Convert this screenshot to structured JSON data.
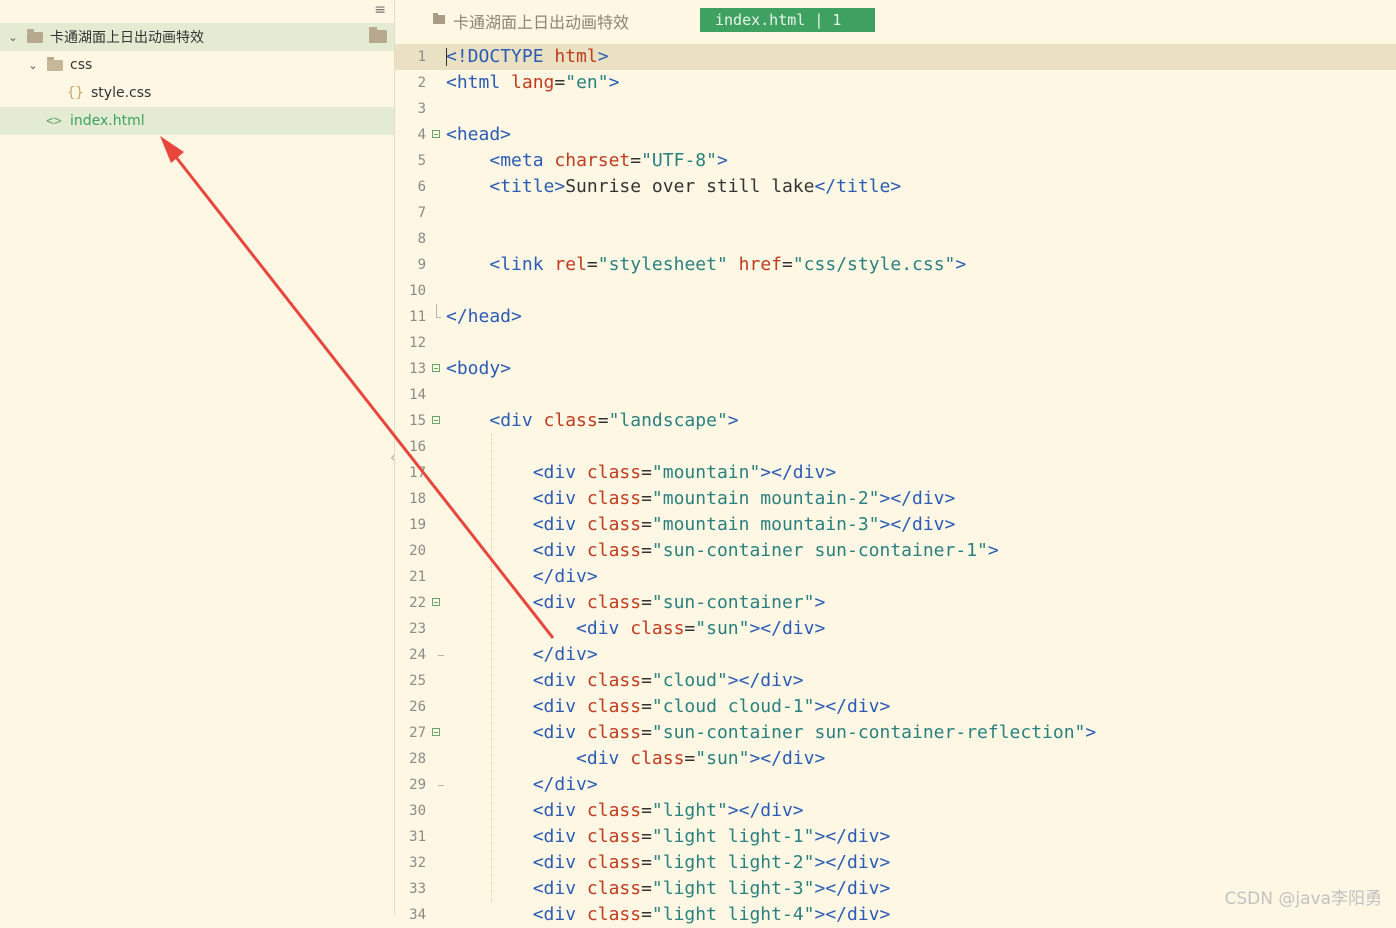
{
  "sidebar": {
    "menu_icon": "hamburger-icon",
    "project_name": "卡通湖面上日出动画特效",
    "folder_css": "css",
    "file_style": "style.css",
    "file_index": "index.html",
    "file_style_icon": "{}",
    "file_index_icon": "<>"
  },
  "editor": {
    "breadcrumb": "卡通湖面上日出动画特效",
    "tab_label": "index.html | 1"
  },
  "code_lines": [
    [
      [
        "t",
        "<!DOCTYPE "
      ],
      [
        "a",
        "html"
      ],
      [
        "t",
        ">"
      ]
    ],
    [
      [
        "t",
        "<html "
      ],
      [
        "a",
        "lang"
      ],
      [
        "x",
        "="
      ],
      [
        "s",
        "\"en\""
      ],
      [
        "t",
        ">"
      ]
    ],
    [],
    [
      [
        "t",
        "<head>"
      ]
    ],
    [
      [
        "x",
        "    "
      ],
      [
        "t",
        "<meta "
      ],
      [
        "a",
        "charset"
      ],
      [
        "x",
        "="
      ],
      [
        "s",
        "\"UTF-8\""
      ],
      [
        "t",
        ">"
      ]
    ],
    [
      [
        "x",
        "    "
      ],
      [
        "t",
        "<title>"
      ],
      [
        "x",
        "Sunrise over still lake"
      ],
      [
        "t",
        "</title>"
      ]
    ],
    [],
    [],
    [
      [
        "x",
        "    "
      ],
      [
        "t",
        "<link "
      ],
      [
        "a",
        "rel"
      ],
      [
        "x",
        "="
      ],
      [
        "s",
        "\"stylesheet\""
      ],
      [
        "x",
        " "
      ],
      [
        "a",
        "href"
      ],
      [
        "x",
        "="
      ],
      [
        "s",
        "\"css/style.css\""
      ],
      [
        "t",
        ">"
      ]
    ],
    [],
    [
      [
        "t",
        "</head>"
      ]
    ],
    [],
    [
      [
        "t",
        "<body>"
      ]
    ],
    [],
    [
      [
        "x",
        "    "
      ],
      [
        "t",
        "<div "
      ],
      [
        "a",
        "class"
      ],
      [
        "x",
        "="
      ],
      [
        "s",
        "\"landscape\""
      ],
      [
        "t",
        ">"
      ]
    ],
    [],
    [
      [
        "x",
        "        "
      ],
      [
        "t",
        "<div "
      ],
      [
        "a",
        "class"
      ],
      [
        "x",
        "="
      ],
      [
        "s",
        "\"mountain\""
      ],
      [
        "t",
        "></div>"
      ]
    ],
    [
      [
        "x",
        "        "
      ],
      [
        "t",
        "<div "
      ],
      [
        "a",
        "class"
      ],
      [
        "x",
        "="
      ],
      [
        "s",
        "\"mountain mountain-2\""
      ],
      [
        "t",
        "></div>"
      ]
    ],
    [
      [
        "x",
        "        "
      ],
      [
        "t",
        "<div "
      ],
      [
        "a",
        "class"
      ],
      [
        "x",
        "="
      ],
      [
        "s",
        "\"mountain mountain-3\""
      ],
      [
        "t",
        "></div>"
      ]
    ],
    [
      [
        "x",
        "        "
      ],
      [
        "t",
        "<div "
      ],
      [
        "a",
        "class"
      ],
      [
        "x",
        "="
      ],
      [
        "s",
        "\"sun-container sun-container-1\""
      ],
      [
        "t",
        ">"
      ]
    ],
    [
      [
        "x",
        "        "
      ],
      [
        "t",
        "</div>"
      ]
    ],
    [
      [
        "x",
        "        "
      ],
      [
        "t",
        "<div "
      ],
      [
        "a",
        "class"
      ],
      [
        "x",
        "="
      ],
      [
        "s",
        "\"sun-container\""
      ],
      [
        "t",
        ">"
      ]
    ],
    [
      [
        "x",
        "            "
      ],
      [
        "t",
        "<div "
      ],
      [
        "a",
        "class"
      ],
      [
        "x",
        "="
      ],
      [
        "s",
        "\"sun\""
      ],
      [
        "t",
        "></div>"
      ]
    ],
    [
      [
        "x",
        "        "
      ],
      [
        "t",
        "</div>"
      ]
    ],
    [
      [
        "x",
        "        "
      ],
      [
        "t",
        "<div "
      ],
      [
        "a",
        "class"
      ],
      [
        "x",
        "="
      ],
      [
        "s",
        "\"cloud\""
      ],
      [
        "t",
        "></div>"
      ]
    ],
    [
      [
        "x",
        "        "
      ],
      [
        "t",
        "<div "
      ],
      [
        "a",
        "class"
      ],
      [
        "x",
        "="
      ],
      [
        "s",
        "\"cloud cloud-1\""
      ],
      [
        "t",
        "></div>"
      ]
    ],
    [
      [
        "x",
        "        "
      ],
      [
        "t",
        "<div "
      ],
      [
        "a",
        "class"
      ],
      [
        "x",
        "="
      ],
      [
        "s",
        "\"sun-container sun-container-reflection\""
      ],
      [
        "t",
        ">"
      ]
    ],
    [
      [
        "x",
        "            "
      ],
      [
        "t",
        "<div "
      ],
      [
        "a",
        "class"
      ],
      [
        "x",
        "="
      ],
      [
        "s",
        "\"sun\""
      ],
      [
        "t",
        "></div>"
      ]
    ],
    [
      [
        "x",
        "        "
      ],
      [
        "t",
        "</div>"
      ]
    ],
    [
      [
        "x",
        "        "
      ],
      [
        "t",
        "<div "
      ],
      [
        "a",
        "class"
      ],
      [
        "x",
        "="
      ],
      [
        "s",
        "\"light\""
      ],
      [
        "t",
        "></div>"
      ]
    ],
    [
      [
        "x",
        "        "
      ],
      [
        "t",
        "<div "
      ],
      [
        "a",
        "class"
      ],
      [
        "x",
        "="
      ],
      [
        "s",
        "\"light light-1\""
      ],
      [
        "t",
        "></div>"
      ]
    ],
    [
      [
        "x",
        "        "
      ],
      [
        "t",
        "<div "
      ],
      [
        "a",
        "class"
      ],
      [
        "x",
        "="
      ],
      [
        "s",
        "\"light light-2\""
      ],
      [
        "t",
        "></div>"
      ]
    ],
    [
      [
        "x",
        "        "
      ],
      [
        "t",
        "<div "
      ],
      [
        "a",
        "class"
      ],
      [
        "x",
        "="
      ],
      [
        "s",
        "\"light light-3\""
      ],
      [
        "t",
        "></div>"
      ]
    ],
    [
      [
        "x",
        "        "
      ],
      [
        "t",
        "<div "
      ],
      [
        "a",
        "class"
      ],
      [
        "x",
        "="
      ],
      [
        "s",
        "\"light light-4\""
      ],
      [
        "t",
        "></div>"
      ]
    ]
  ],
  "fold_markers": {
    "4": "open",
    "11": "tail",
    "13": "open",
    "15": "open",
    "22": "open",
    "24": "dash",
    "27": "open",
    "29": "dash"
  },
  "colors": {
    "background": "#fdf7e3",
    "tab_green": "#3ea061",
    "selection": "#e3ecd3",
    "arrow": "#e8463c"
  },
  "watermark": "CSDN @java李阳勇"
}
